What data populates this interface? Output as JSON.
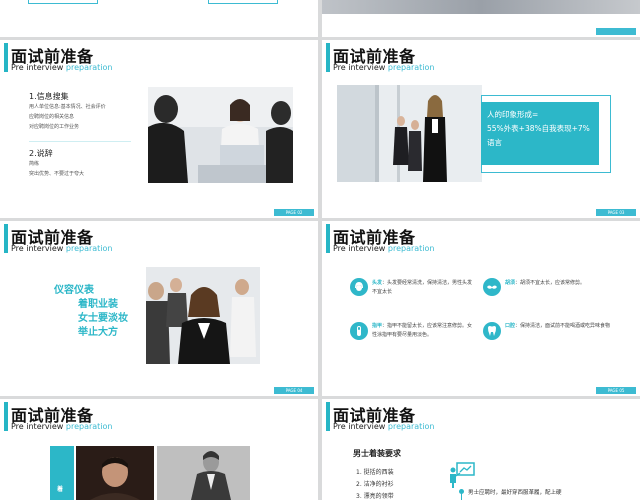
{
  "slides": {
    "title": "面试前准备",
    "subtitle_a": "Pre interview",
    "subtitle_b": "preparation"
  },
  "slide2": {
    "page": "PAGE 02",
    "section1_title": "1.信息搜集",
    "section1_lines": [
      "用人单位信息:基本情况、社会评价",
      "应聘岗位的相关信息",
      "对应聘岗位的工作业务"
    ],
    "section2_title": "2.说辞",
    "section2_lines": [
      "简练",
      "突出优势、不要过于夸大"
    ]
  },
  "slide3": {
    "page": "PAGE 03",
    "box_line1": "人的印象形成=",
    "box_line2": "55%外表+38%自我表现+7%",
    "box_line3": "语言"
  },
  "slide4": {
    "page": "PAGE 04",
    "lines": [
      "仪容仪表",
      "着职业装",
      "女士要淡妆",
      "举止大方"
    ]
  },
  "slide5": {
    "page": "PAGE 05",
    "items": [
      {
        "label": "头发",
        "text": "头发要经常清洗，保持清洁，男性头发不宜太长",
        "icon": "hair-icon"
      },
      {
        "label": "胡须",
        "text": "胡须不宜太长，应该常修剪。",
        "icon": "beard-icon"
      },
      {
        "label": "指甲",
        "text": "指甲不能留太长，应该常注意修剪。女性涂指甲有要尽量用淡色。",
        "icon": "nail-icon"
      },
      {
        "label": "口腔",
        "text": "保持清洁，面试前不能喝酒或吃异味食物",
        "icon": "tooth-icon"
      }
    ]
  },
  "slide6": {
    "side_label": "着"
  },
  "slide7": {
    "heading": "男士着装要求",
    "list": [
      "1. 挺括的西装",
      "2. 洁净的衬衫",
      "3. 漂亮的领带"
    ],
    "note": "男士应聘时，最好穿西服革履，配上硬"
  },
  "colors": {
    "accent": "#26b5c5"
  }
}
